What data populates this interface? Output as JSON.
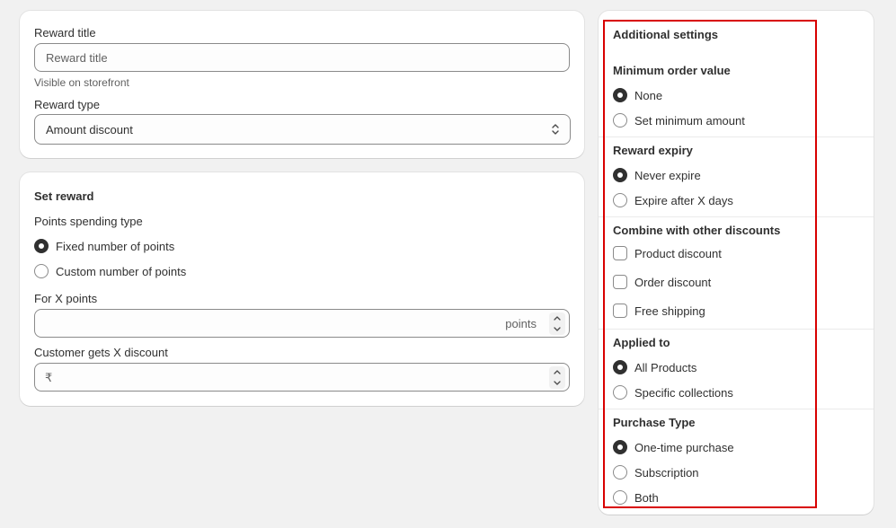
{
  "reward_info": {
    "title_label": "Reward title",
    "title_placeholder": "Reward title",
    "title_value": "",
    "title_help": "Visible on storefront",
    "type_label": "Reward type",
    "type_value": "Amount discount"
  },
  "set_reward": {
    "heading": "Set reward",
    "spending_type_label": "Points spending type",
    "spending_options": [
      {
        "label": "Fixed number of points",
        "checked": true
      },
      {
        "label": "Custom number of points",
        "checked": false
      }
    ],
    "points_label": "For X points",
    "points_value": "",
    "points_suffix": "points",
    "discount_label": "Customer gets X discount",
    "discount_prefix": "₹",
    "discount_value": ""
  },
  "additional": {
    "heading": "Additional settings",
    "min_order": {
      "heading": "Minimum order value",
      "options": [
        {
          "label": "None",
          "checked": true
        },
        {
          "label": "Set minimum amount",
          "checked": false
        }
      ]
    },
    "expiry": {
      "heading": "Reward expiry",
      "options": [
        {
          "label": "Never expire",
          "checked": true
        },
        {
          "label": "Expire after X days",
          "checked": false
        }
      ]
    },
    "combine": {
      "heading": "Combine with other discounts",
      "options": [
        {
          "label": "Product discount",
          "checked": false
        },
        {
          "label": "Order discount",
          "checked": false
        },
        {
          "label": "Free shipping",
          "checked": false
        }
      ]
    },
    "applied_to": {
      "heading": "Applied to",
      "options": [
        {
          "label": "All Products",
          "checked": true
        },
        {
          "label": "Specific collections",
          "checked": false
        }
      ]
    },
    "purchase_type": {
      "heading": "Purchase Type",
      "options": [
        {
          "label": "One-time purchase",
          "checked": true
        },
        {
          "label": "Subscription",
          "checked": false
        },
        {
          "label": "Both",
          "checked": false
        }
      ]
    }
  },
  "colors": {
    "highlight": "#d80000",
    "background": "#f1f1f1",
    "card": "#ffffff",
    "text": "#303030"
  }
}
